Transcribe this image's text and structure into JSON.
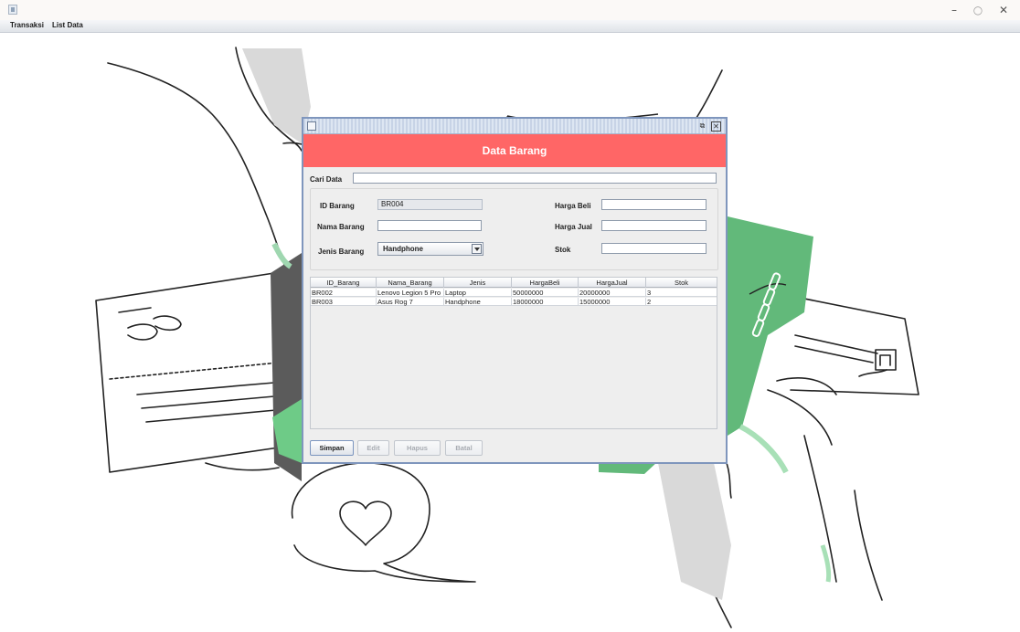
{
  "window": {
    "controls": {
      "minimize": "–",
      "maximize": "○",
      "close": "✕"
    }
  },
  "menubar": {
    "items": [
      "Transaksi",
      "List Data"
    ]
  },
  "frame": {
    "header_title": "Data Barang",
    "accent_color": "#ff6666"
  },
  "search": {
    "label": "Cari Data",
    "value": ""
  },
  "form": {
    "id_barang": {
      "label": "ID Barang",
      "value": "BR004"
    },
    "nama_barang": {
      "label": "Nama Barang",
      "value": ""
    },
    "jenis_barang": {
      "label": "Jenis Barang",
      "value": "Handphone"
    },
    "harga_beli": {
      "label": "Harga Beli",
      "value": ""
    },
    "harga_jual": {
      "label": "Harga Jual",
      "value": ""
    },
    "stok": {
      "label": "Stok",
      "value": ""
    }
  },
  "table": {
    "columns": [
      "ID_Barang",
      "Nama_Barang",
      "Jenis",
      "HargaBeli",
      "HargaJual",
      "Stok"
    ],
    "rows": [
      [
        "BR002",
        "Lenovo Legion 5 Pro",
        "Laptop",
        "50000000",
        "20000000",
        "3"
      ],
      [
        "BR003",
        "Asus Rog 7",
        "Handphone",
        "18000000",
        "15000000",
        "2"
      ]
    ]
  },
  "buttons": {
    "simpan": "Simpan",
    "edit": "Edit",
    "hapus": "Hapus",
    "batal": "Batal"
  }
}
